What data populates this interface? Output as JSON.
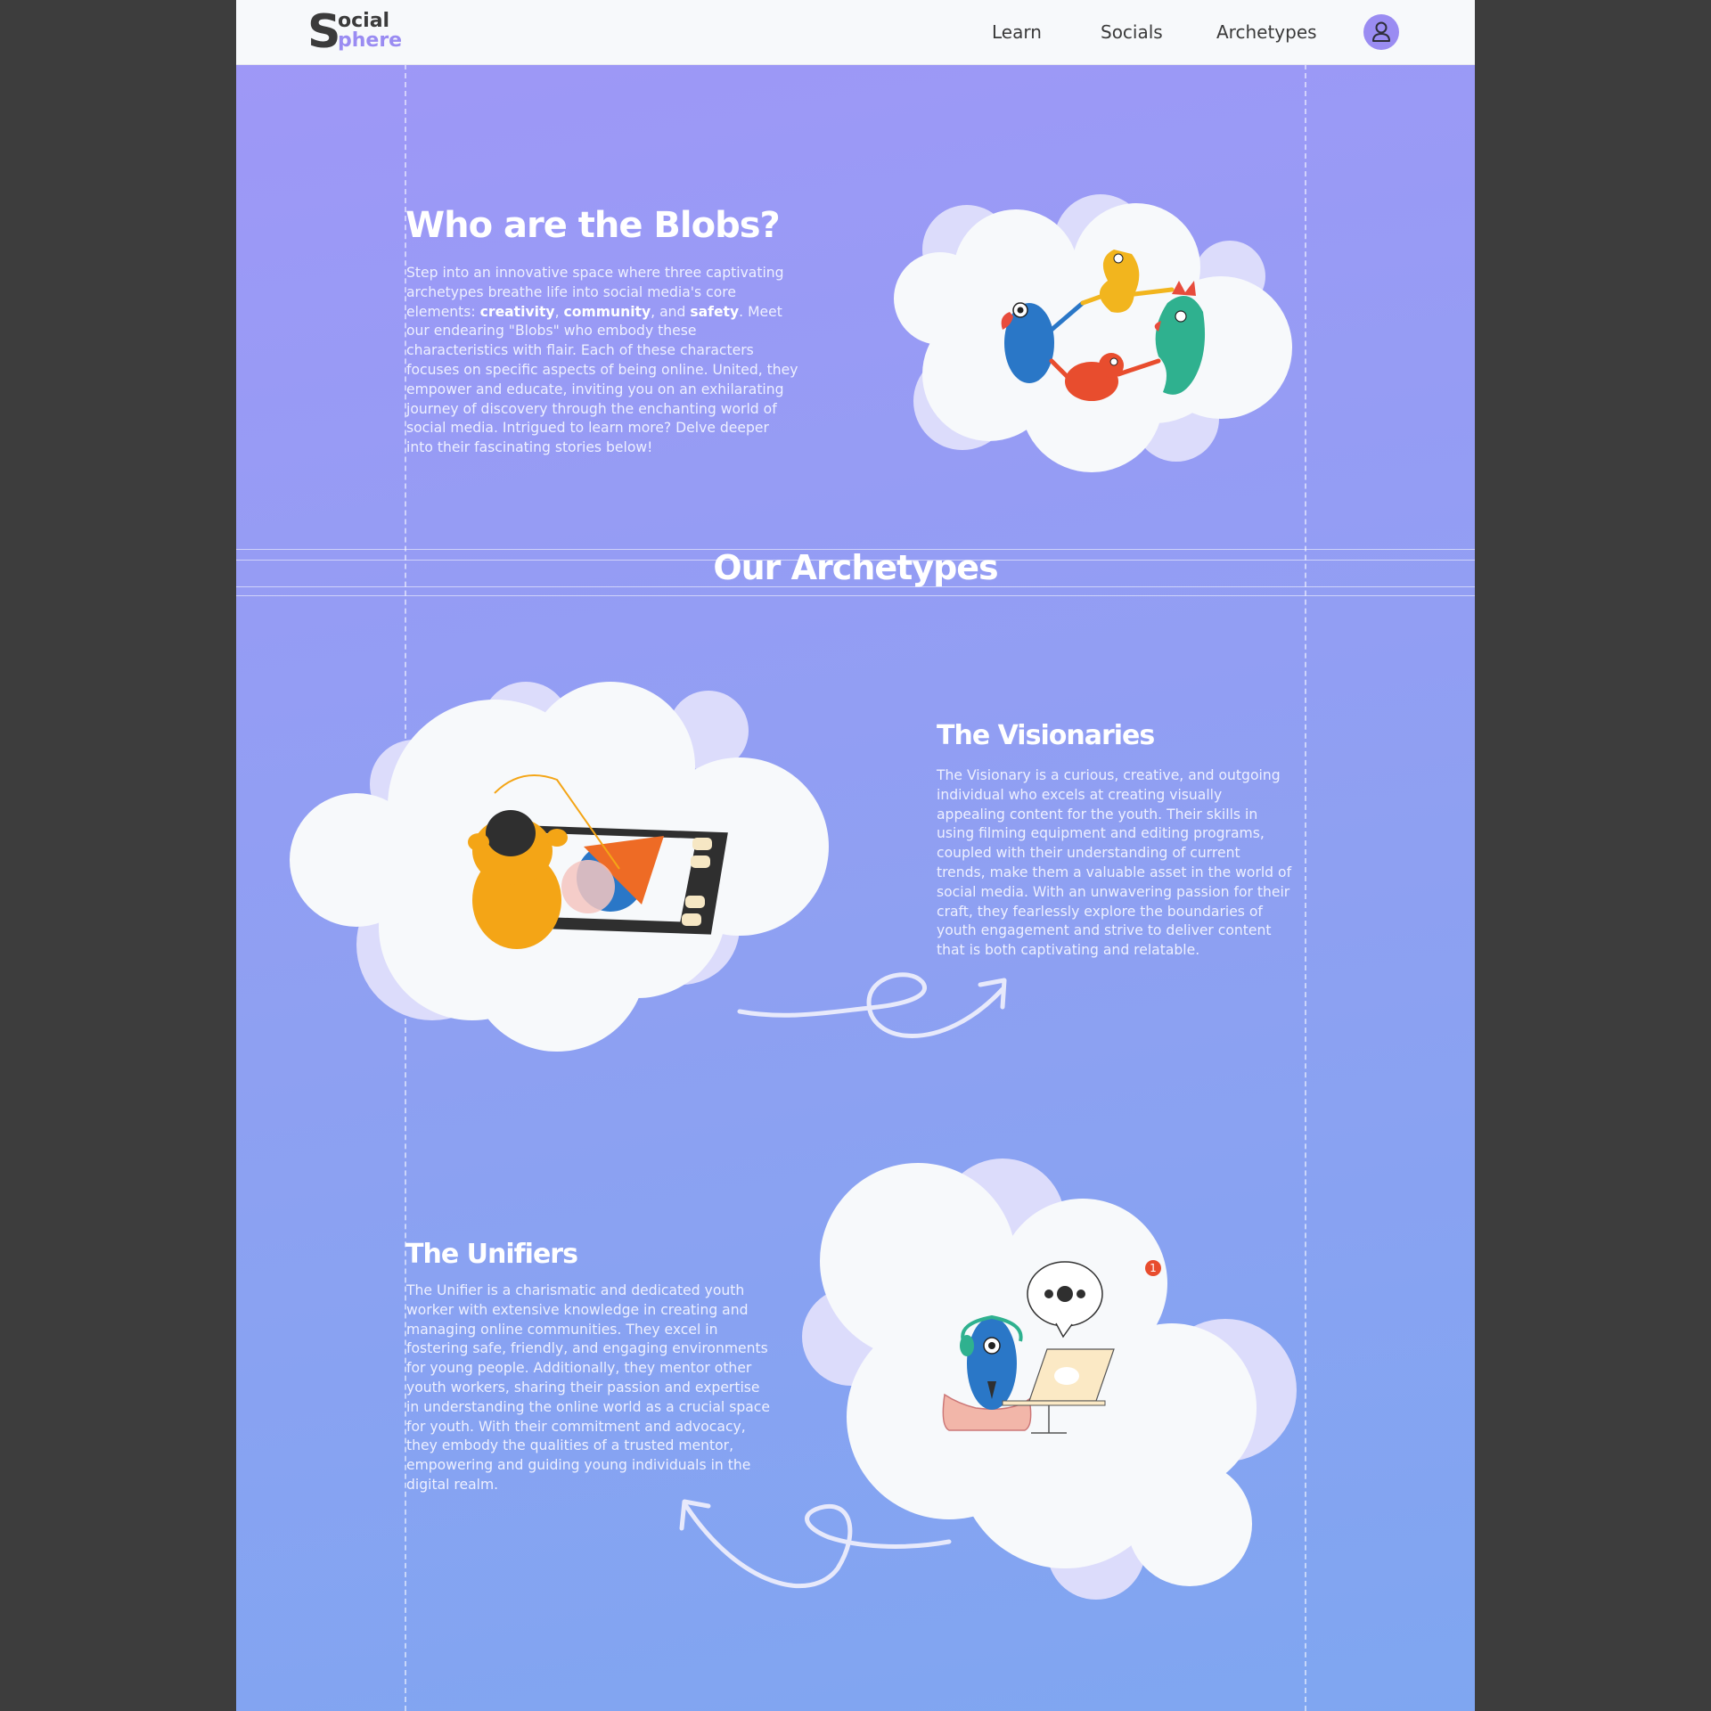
{
  "nav": {
    "logo_letter": "S",
    "logo_top": "ocial",
    "logo_bottom": "phere",
    "links": [
      "Learn",
      "Socials",
      "Archetypes"
    ]
  },
  "intro": {
    "title": "Who are the Blobs?",
    "text_before": "Step into an innovative space where three captivating archetypes breathe life into social media's core elements: ",
    "bold_1": "creativity",
    "sep_1": ", ",
    "bold_2": "community",
    "sep_2": ", and ",
    "bold_3": "safety",
    "text_after": ". Meet our endearing \"Blobs\" who embody these characteristics with flair. Each of these characters focuses on specific aspects of being online. United, they empower and educate, inviting you on an exhilarating journey of discovery through the enchanting world of social media. Intrigued to learn more? Delve deeper into their fascinating stories below!"
  },
  "archetypes_title": "Our Archetypes",
  "visionaries": {
    "title": "The Visionaries",
    "text": "The Visionary is a curious, creative, and outgoing individual who excels at creating visually appealing content for the youth. Their skills in using filming equipment and editing programs, coupled with their understanding of current trends, make them a valuable asset in the world of social media. With an unwavering passion for their craft, they fearlessly explore the boundaries of youth engagement and strive to deliver content that is both captivating and relatable."
  },
  "unifiers": {
    "title": "The Unifiers",
    "text": "The Unifier is a charismatic and dedicated youth worker with extensive knowledge in creating and managing online communities. They excel in fostering safe, friendly, and engaging environments for young people. Additionally, they mentor other youth workers, sharing their passion and expertise in understanding the online world as a crucial space for youth. With their commitment and advocacy, they embody the qualities of a trusted mentor, empowering and guiding young individuals in the digital realm.",
    "notification_count": "1"
  },
  "colors": {
    "accent": "#9a8cf2",
    "background_top": "#9f97f7",
    "background_bottom": "#7fa6f1",
    "outer": "#3d3d3d"
  }
}
